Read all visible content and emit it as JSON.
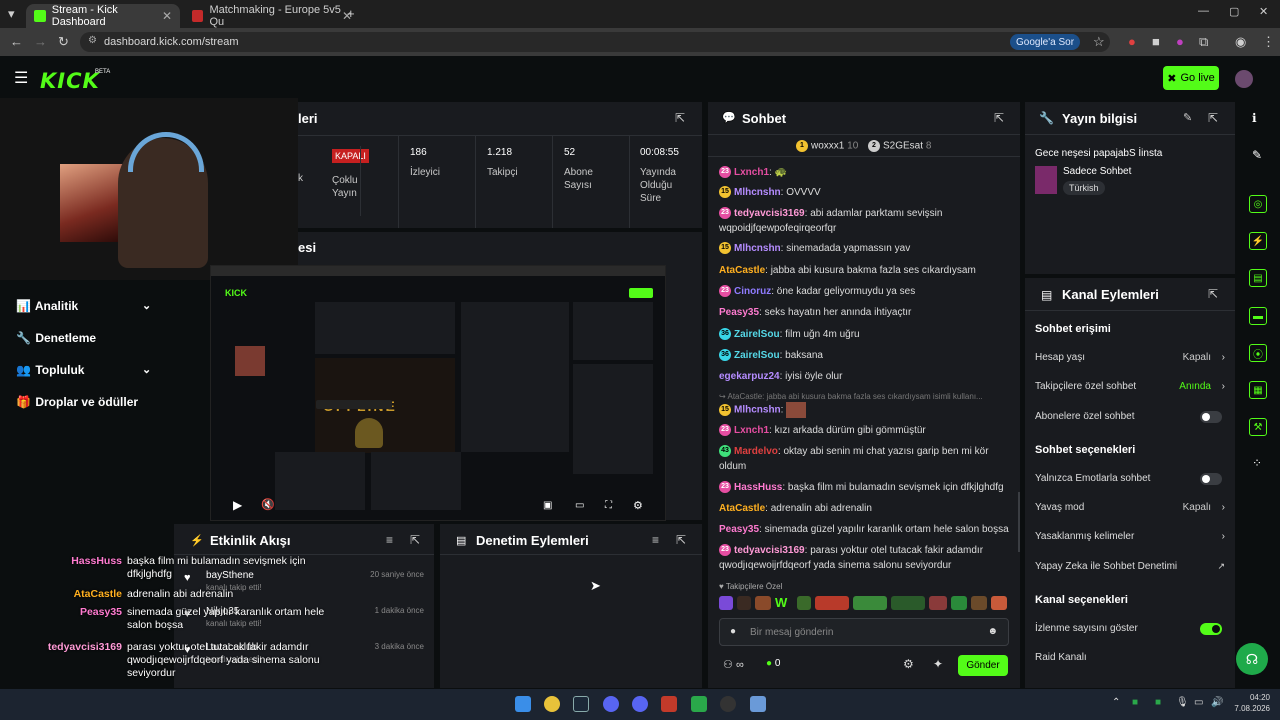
{
  "browser": {
    "tabs": [
      {
        "title": "Stream - Kick Dashboard",
        "active": true
      },
      {
        "title": "Matchmaking - Europe 5v5 Qu",
        "active": false
      }
    ],
    "url": "dashboard.kick.com/stream",
    "google_button": "Google'a Sor"
  },
  "header": {
    "logo": "KICK",
    "beta": "BETA",
    "go_live": "Go live"
  },
  "left_nav": {
    "items": [
      {
        "label": "Analitik",
        "icon": "chart-icon",
        "expandable": true
      },
      {
        "label": "Denetleme",
        "icon": "wrench-icon",
        "expandable": false
      },
      {
        "label": "Topluluk",
        "icon": "users-icon",
        "expandable": true
      },
      {
        "label": "Droplar ve ödüller",
        "icon": "gift-icon",
        "expandable": false
      }
    ]
  },
  "session": {
    "title_partial": "leri",
    "stats": [
      {
        "value": "KAPALI",
        "label": "Çoklu Yayın",
        "is_badge": true
      },
      {
        "value": "186",
        "label": "İzleyici"
      },
      {
        "value": "1.218",
        "label": "Takipçi"
      },
      {
        "value": "52",
        "label": "Abone Sayısı"
      },
      {
        "value": "00:08:55",
        "label": "Yayında Olduğu Süre"
      }
    ],
    "left_clip": "k",
    "preview_title_partial": "esi"
  },
  "activity_feed": {
    "title": "Etkinlik Akışı",
    "items": [
      {
        "name": "baySthene",
        "sub": "kanalı takip etti!",
        "time": "20 saniye önce"
      },
      {
        "name": "Nikjo35",
        "sub": "kanalı takip etti!",
        "time": "1 dakika önce"
      },
      {
        "name": "LavaLeclub",
        "sub": "kanalı takip etti!",
        "time": "3 dakika önce"
      }
    ]
  },
  "overlay_chat": [
    {
      "user": "HassHuss",
      "color": "#ff7bd0",
      "text": "başka film mi bulamadın sevişmek için dfkjlghdfg"
    },
    {
      "user": "AtaCastle",
      "color": "#ffb020",
      "text": "adrenalin abi adrenalin"
    },
    {
      "user": "Peasy35",
      "color": "#ff7bd0",
      "text": "sinemada güzel yapılır karanlık ortam hele salon boşsa"
    },
    {
      "user": "tedyavcisi3169",
      "color": "#ff9ad6",
      "text": "parası yoktur otel tutacak fakir adamdır qwodjıqewoijrfdqeorf yada sinema salonu seviyordur"
    }
  ],
  "moderation": {
    "title": "Denetim Eylemleri"
  },
  "chat": {
    "title": "Sohbet",
    "pinned": [
      {
        "name": "woxxx1",
        "count": "10"
      },
      {
        "name": "S2GEsat",
        "count": "8"
      }
    ],
    "messages": [
      {
        "badge": "23",
        "badge_class": "b-pink",
        "user": "Lxnch1",
        "color": "#e64ea2",
        "text": "🐢"
      },
      {
        "badge": "15",
        "badge_class": "b-yel",
        "user": "Mlhcnshn",
        "color": "#b58cff",
        "text": "OVVVV"
      },
      {
        "badge": "23",
        "badge_class": "b-pink",
        "user": "tedyavcisi3169",
        "color": "#ff9ad6",
        "text": "abi adamlar parktamı sevişsin wqpoidjfqewpofeqirqeorfqr"
      },
      {
        "badge": "15",
        "badge_class": "b-yel",
        "user": "Mlhcnshn",
        "color": "#b58cff",
        "text": "sinemadada yapmassın yav"
      },
      {
        "badge": "",
        "badge_class": "",
        "user": "AtaCastle",
        "color": "#ffb020",
        "text": "jabba abi kusura bakma fazla ses cıkardıysam"
      },
      {
        "badge": "23",
        "badge_class": "b-pink",
        "user": "Cinoruz",
        "color": "#8f7bff",
        "text": "öne kadar geliyormuydu ya ses"
      },
      {
        "badge": "",
        "badge_class": "",
        "user": "Peasy35",
        "color": "#ff7bd0",
        "text": "seks hayatın her anında ihtiyaçtır"
      },
      {
        "badge": "36",
        "badge_class": "b-cyan",
        "user": "ZairelSou",
        "color": "#56d9e8",
        "text": "film uğn 4m uğru"
      },
      {
        "badge": "36",
        "badge_class": "b-cyan",
        "user": "ZairelSou",
        "color": "#56d9e8",
        "text": "baksana"
      },
      {
        "badge": "",
        "badge_class": "",
        "user": "egekarpuz24",
        "color": "#b58cff",
        "text": "iyisi öyle olur"
      },
      {
        "badge": "",
        "badge_class": "",
        "user": "AtaCastle",
        "color": "#8a8a8a",
        "text": "jabba abi kusura bakma fazla ses cıkardıysam isimli kullanı..."
      },
      {
        "badge": "15",
        "badge_class": "b-yel",
        "user": "Mlhcnshn",
        "color": "#b58cff",
        "text": "🖼"
      },
      {
        "badge": "23",
        "badge_class": "b-pink",
        "user": "Lxnch1",
        "color": "#e64ea2",
        "text": "kızı arkada dürüm gibi gömmüştür"
      },
      {
        "badge": "43",
        "badge_class": "b-green",
        "user": "Mardelvo",
        "color": "#e04040",
        "text": "oktay abi senin mi chat yazısı garip ben mi kör oldum"
      },
      {
        "badge": "23",
        "badge_class": "b-pink",
        "user": "HassHuss",
        "color": "#ff7bd0",
        "text": "başka film mi bulamadın sevişmek için dfkjlghdfg"
      },
      {
        "badge": "",
        "badge_class": "",
        "user": "AtaCastle",
        "color": "#ffb020",
        "text": "adrenalin abi adrenalin"
      },
      {
        "badge": "",
        "badge_class": "",
        "user": "Peasy35",
        "color": "#ff7bd0",
        "text": "sinemada güzel yapılır karanlık ortam hele salon boşsa"
      },
      {
        "badge": "23",
        "badge_class": "b-pink",
        "user": "tedyavcisi3169",
        "color": "#ff9ad6",
        "text": "parası yoktur otel tutacak fakir adamdır qwodjıqewoijrfdqeorf yada sinema salonu seviyordur"
      }
    ],
    "followers_only": "Takipçilere Özel",
    "input_placeholder": "Bir mesaj gönderin",
    "infinite": "∞",
    "points": "0",
    "send": "Gönder"
  },
  "stream_info": {
    "title": "Yayın bilgisi",
    "stream_title": "Gece neşesi papajabS İinsta",
    "category": "Sadece Sohbet",
    "language": "Türkish"
  },
  "channel_actions": {
    "title": "Kanal Eylemleri",
    "chat_access_title": "Sohbet erişimi",
    "chat_access": [
      {
        "label": "Hesap yaşı",
        "value": "Kapalı",
        "type": "chevron"
      },
      {
        "label": "Takipçilere özel sohbet",
        "value": "Anında",
        "type": "chevron",
        "accent": true
      },
      {
        "label": "Abonelere özel sohbet",
        "value": "",
        "type": "toggle",
        "on": false
      }
    ],
    "chat_options_title": "Sohbet seçenekleri",
    "chat_options": [
      {
        "label": "Yalnızca Emotlarla sohbet",
        "value": "",
        "type": "toggle",
        "on": false
      },
      {
        "label": "Yavaş mod",
        "value": "Kapalı",
        "type": "chevron"
      },
      {
        "label": "Yasaklanmış kelimeler",
        "value": "",
        "type": "chevron"
      },
      {
        "label": "Yapay Zeka ile Sohbet Denetimi",
        "value": "",
        "type": "external"
      }
    ],
    "channel_options_title": "Kanal seçenekleri",
    "channel_options": [
      {
        "label": "İzlenme sayısını göster",
        "value": "",
        "type": "toggle",
        "on": true
      },
      {
        "label": "Raid Kanalı",
        "value": "",
        "type": "none"
      }
    ]
  },
  "taskbar": {
    "time": "04:20",
    "date": "7.08.2026"
  },
  "colors": {
    "accent": "#53fc18",
    "panel": "#191b1f",
    "background": "#0b0e0f"
  }
}
